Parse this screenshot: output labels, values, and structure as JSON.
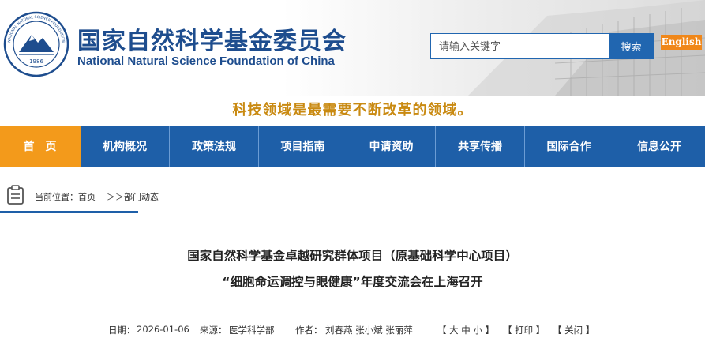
{
  "header": {
    "title_cn": "国家自然科学基金委员会",
    "title_en": "National Natural Science Foundation of China",
    "logo": {
      "icon": "nsfc-logo-icon",
      "year": "1986",
      "ring_text": "NATIONAL NATURAL SCIENCE FOUNDATION OF CHINA"
    },
    "search": {
      "placeholder": "请输入关键字",
      "button_label": "搜索"
    },
    "english_label": "English"
  },
  "slogan": "科技领域是最需要不断改革的领域。",
  "nav": {
    "items": [
      {
        "label": "首　页",
        "active": true
      },
      {
        "label": "机构概况"
      },
      {
        "label": "政策法规"
      },
      {
        "label": "项目指南"
      },
      {
        "label": "申请资助"
      },
      {
        "label": "共享传播"
      },
      {
        "label": "国际合作"
      },
      {
        "label": "信息公开"
      }
    ]
  },
  "breadcrumb": {
    "icon": "location-icon",
    "prefix": "当前位置：",
    "home": "首页",
    "separator": "＞＞",
    "current": "部门动态"
  },
  "article": {
    "title_line1": "国家自然科学基金卓越研究群体项目（原基础科学中心项目）",
    "title_line2": "“细胞命运调控与眼健康”年度交流会在上海召开",
    "meta": {
      "date_label": "日期：",
      "date": "2026-01-06",
      "source_label": "来源：",
      "source": "医学科学部",
      "author_label": "作者：",
      "authors": "刘春燕 张小斌 张丽萍",
      "font_size": "【 大 中 小 】",
      "print": "【 打印 】",
      "close": "【 关闭 】"
    }
  },
  "colors": {
    "brand_blue": "#1e5fa8",
    "title_blue": "#1e4d8e",
    "orange": "#f39a1b",
    "slogan_gold": "#c98a12"
  }
}
